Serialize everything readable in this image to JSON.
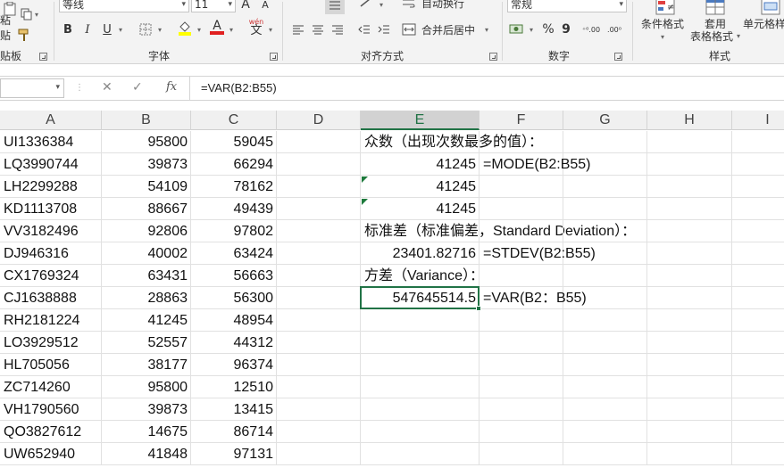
{
  "ribbon": {
    "paste_label": "粘贴",
    "clipboard_label": "贴板",
    "font_name": "等线",
    "font_size": "11",
    "font_group_label": "字体",
    "align_group_label": "对齐方式",
    "wrap_text_label": "自动换行",
    "merge_center_label": "合并后居中",
    "number_format": "常规",
    "number_group_label": "数字",
    "conditional_format_label": "条件格式",
    "table_format_label_1": "套用",
    "table_format_label_2": "表格格式",
    "cell_style_label": "单元格样",
    "styles_group_label": "样式",
    "bold": "B",
    "italic": "I",
    "underline": "U",
    "font_color_letter": "A",
    "grow_font": "A",
    "shrink_font": "A",
    "phonetic_top": "wén",
    "phonetic_bottom": "文",
    "percent": "%",
    "comma": "9",
    "inc_decimal": "⁺⁰.00",
    "dec_decimal": ".00⁰"
  },
  "formula_bar": {
    "name_box": "",
    "fx_label": "fx",
    "formula": "=VAR(B2:B55)"
  },
  "columns": [
    "A",
    "B",
    "C",
    "D",
    "E",
    "F",
    "G",
    "H",
    "I"
  ],
  "active_column": "E",
  "data_rows": [
    [
      "UI1336384",
      "95800",
      "59045"
    ],
    [
      "LQ3990744",
      "39873",
      "66294"
    ],
    [
      "LH2299288",
      "54109",
      "78162"
    ],
    [
      "KD1113708",
      "88667",
      "49439"
    ],
    [
      "VV3182496",
      "92806",
      "97802"
    ],
    [
      "DJ946316",
      "40002",
      "63424"
    ],
    [
      "CX1769324",
      "63431",
      "56663"
    ],
    [
      "CJ1638888",
      "28863",
      "56300"
    ],
    [
      "RH2181224",
      "41245",
      "48954"
    ],
    [
      "LO3929512",
      "52557",
      "44312"
    ],
    [
      "HL705056",
      "38177",
      "96374"
    ],
    [
      "ZC714260",
      "95800",
      "12510"
    ],
    [
      "VH1790560",
      "39873",
      "13415"
    ],
    [
      "QO3827612",
      "14675",
      "86714"
    ],
    [
      "UW652940",
      "41848",
      "97131"
    ]
  ],
  "stats": {
    "mode_heading": "众数（出现次数最多的值）：",
    "mode_value_1": "41245",
    "mode_formula": "=MODE(B2:B55)",
    "mode_value_2": "41245",
    "mode_value_3": "41245",
    "stdev_heading": "标准差（标准偏差，Standard Deviation）：",
    "stdev_value": "23401.82716",
    "stdev_formula": "=STDEV(B2:B55)",
    "var_heading": " 方差（Variance）：",
    "var_value": "547645514.5",
    "var_formula": "=VAR(B2：B55)"
  },
  "colors": {
    "accent": "#217346",
    "error_triangle": "#1e7a3c"
  }
}
